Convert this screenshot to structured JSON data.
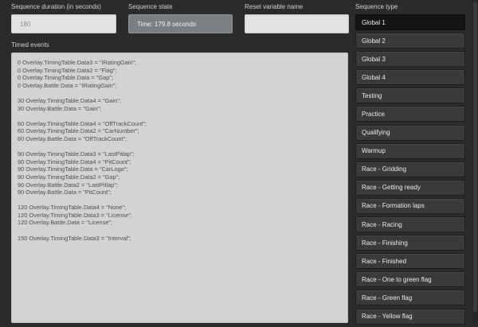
{
  "labels": {
    "duration": "Sequence duration (in seconds)",
    "state": "Sequence state",
    "reset": "Reset variable name",
    "type": "Sequence type",
    "events": "Timed events"
  },
  "fields": {
    "duration_value": "180",
    "state_value": "Time: 179.8 seconds",
    "reset_value": ""
  },
  "events": [
    "0 Overlay.TimingTable.Data3 = \"IRatingGain\";",
    "0 Overlay.TimingTable.Data2 = \"Flag\";",
    "0 Overlay.TimingTable.Data = \"Gap\";",
    "0 Overlay.Battle.Data = \"IRatingGain\";",
    "",
    "30 Overlay.TimingTable.Data4 = \"Gain\";",
    "30 Overlay.Battle.Data = \"Gain\";",
    "",
    "60 Overlay.TimingTable.Data4 = \"OffTrackCount\";",
    "60 Overlay.TimingTable.Data2 = \"CarNumber\";",
    "60 Overlay.Battle.Data = \"OffTrackCount\";",
    "",
    "90 Overlay.TimingTable.Data3 = \"LastPitlap\";",
    "90 Overlay.TimingTable.Data4 = \"PitCount\";",
    "90 Overlay.TimingTable.Data = \"CarLogo\";",
    "90 Overlay.TimingTable.Data2 = \"Gap\";",
    "90 Overlay.Battle.Data2 = \"LastPitlap\";",
    "90 Overlay.Battle.Data = \"PitCount\";",
    "",
    "120 Overlay.TimingTable.Data4 = \"None\";",
    "120 Overlay.TimingTable.Data3 = \"License\";",
    "120 Overlay.Battle.Data = \"License\";",
    "",
    "150 Overlay.TimingTable.Data3 = \"Interval\";"
  ],
  "sequence_types": [
    "Global 1",
    "Global 2",
    "Global 3",
    "Global 4",
    "Testing",
    "Practice",
    "Qualifying",
    "Warmup",
    "Race - Gridding",
    "Race - Getting ready",
    "Race - Formation laps",
    "Race - Racing",
    "Race - Finishing",
    "Race - Finished",
    "Race - One to green flag",
    "Race - Green flag",
    "Race - Yellow flag"
  ],
  "selected_sequence_type": "Global 1"
}
